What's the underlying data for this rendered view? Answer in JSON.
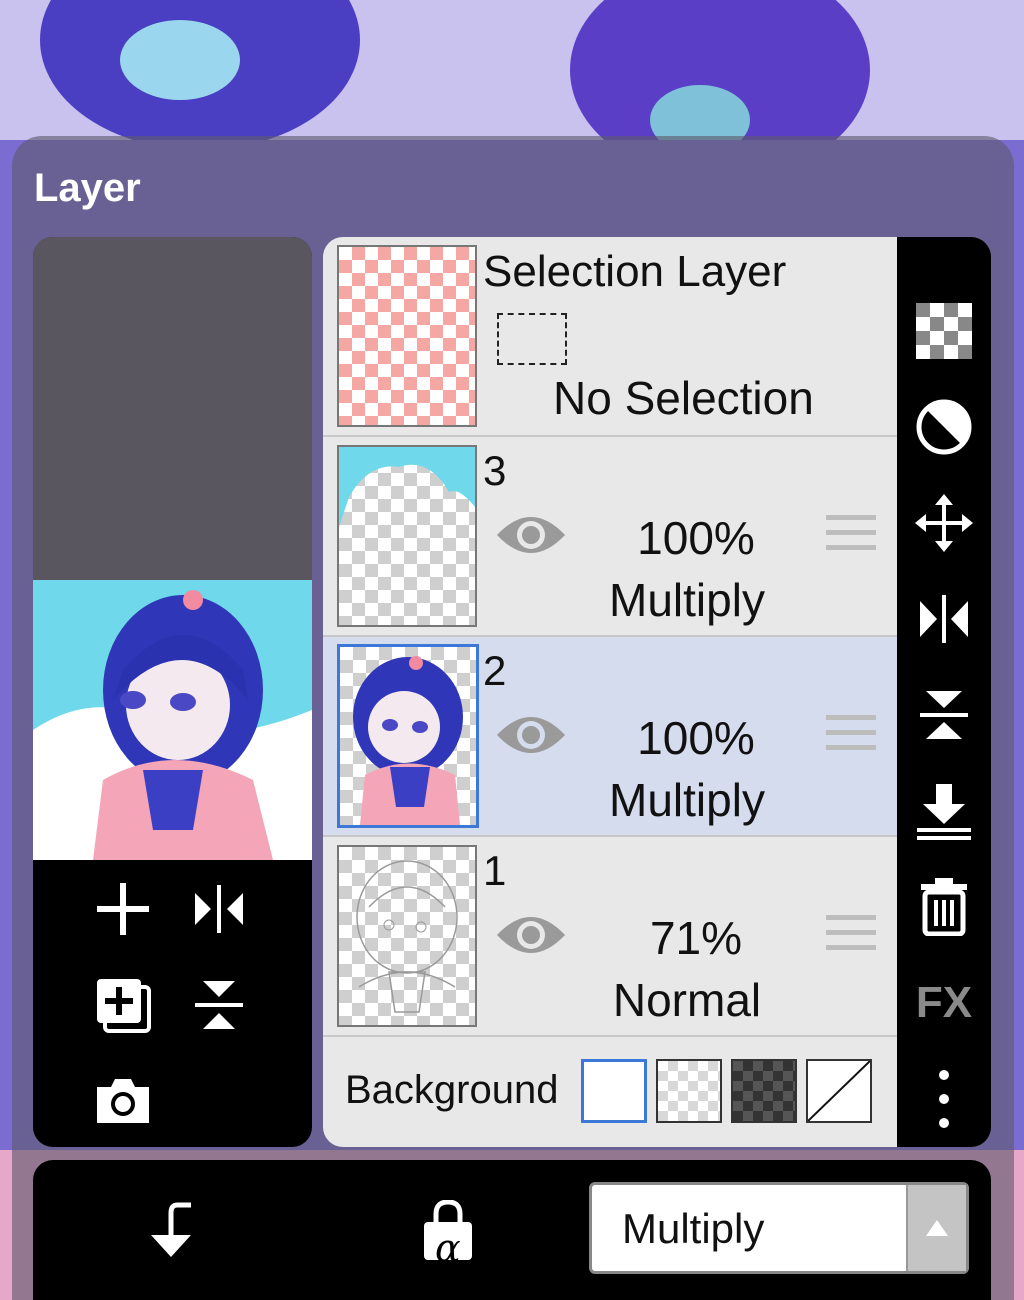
{
  "panel": {
    "title": "Layer"
  },
  "left_tools": {
    "add_label": "add-layer",
    "icons": [
      "plus-icon",
      "flip-horizontal-icon",
      "duplicate-layer-icon",
      "flip-vertical-icon",
      "camera-icon"
    ]
  },
  "selection_layer": {
    "title": "Selection Layer",
    "status": "No Selection"
  },
  "layers": [
    {
      "number": "3",
      "opacity": "100%",
      "blend_mode": "Multiply",
      "selected": false,
      "visible": true
    },
    {
      "number": "2",
      "opacity": "100%",
      "blend_mode": "Multiply",
      "selected": true,
      "visible": true
    },
    {
      "number": "1",
      "opacity": "71%",
      "blend_mode": "Normal",
      "selected": false,
      "visible": true
    }
  ],
  "background": {
    "label": "Background",
    "options": [
      "white",
      "transparent-light",
      "transparent-dark",
      "none"
    ],
    "selected": "white"
  },
  "toolbar": {
    "icons": [
      "checkerboard-icon",
      "opacity-circle-icon",
      "move-icon",
      "flip-horizontal-icon",
      "flip-vertical-icon",
      "merge-down-icon",
      "trash-icon",
      "fx-icon",
      "more-vert-icon"
    ],
    "fx_label": "FX"
  },
  "bottom_bar": {
    "blend_mode_value": "Multiply",
    "icons": [
      "clipping-icon",
      "alpha-lock-icon",
      "dropdown-arrow-icon"
    ],
    "alpha_glyph": "α"
  },
  "colors": {
    "selected_row": "#d4dcee",
    "active_border": "#3b78d8",
    "list_bg": "#e8e8e8"
  }
}
